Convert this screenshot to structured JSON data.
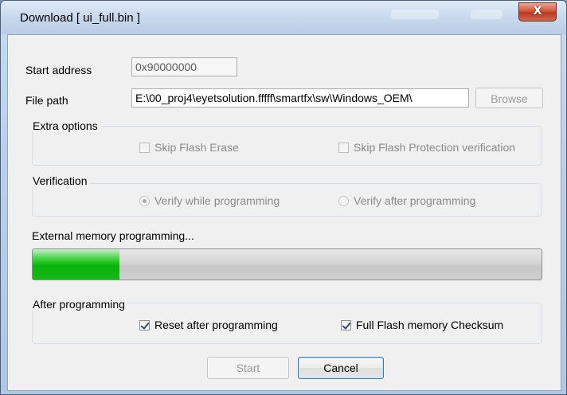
{
  "window": {
    "title": "Download [ ui_full.bin ]",
    "close_glyph": "X"
  },
  "form": {
    "start_address": {
      "label": "Start address",
      "value": "0x90000000"
    },
    "file_path": {
      "label": "File path",
      "value": "E:\\00_proj4\\eyetsolution.fffff\\smartfx\\sw\\Windows_OEM\\"
    },
    "browse_label": "Browse"
  },
  "extra_options": {
    "title": "Extra options",
    "skip_flash_erase": {
      "label": "Skip Flash Erase",
      "checked": false,
      "enabled": false
    },
    "skip_flash_protection": {
      "label": "Skip Flash Protection verification",
      "checked": false,
      "enabled": false
    }
  },
  "verification": {
    "title": "Verification",
    "verify_while": {
      "label": "Verify while programming",
      "selected": true,
      "enabled": false
    },
    "verify_after": {
      "label": "Verify after programming",
      "selected": false,
      "enabled": false
    }
  },
  "progress": {
    "status": "External memory programming...",
    "fraction": 0.17,
    "color": "#1cc21c"
  },
  "after_programming": {
    "title": "After programming",
    "reset": {
      "label": "Reset after programming",
      "checked": true
    },
    "checksum": {
      "label": "Full Flash memory Checksum",
      "checked": true
    }
  },
  "buttons": {
    "start_label": "Start",
    "cancel_label": "Cancel"
  }
}
